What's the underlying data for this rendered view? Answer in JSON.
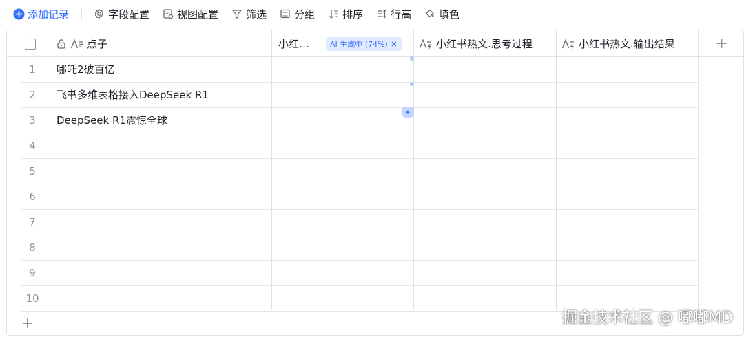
{
  "toolbar": {
    "add_record": "添加记录",
    "field_config": "字段配置",
    "view_config": "视图配置",
    "filter": "筛选",
    "group": "分组",
    "sort": "排序",
    "row_height": "行高",
    "fill_color": "填色"
  },
  "columns": {
    "primary": "点子",
    "col2": "小红…",
    "ai_badge": "AI 生成中 (74%)",
    "ai_badge_close": "×",
    "col3": "小红书热文.思考过程",
    "col4": "小红书热文.输出结果",
    "add": "+"
  },
  "rows": [
    {
      "num": "1",
      "text": "哪吒2破百亿"
    },
    {
      "num": "2",
      "text": "飞书多维表格接入DeepSeek R1"
    },
    {
      "num": "3",
      "text": "DeepSeek R1震惊全球"
    },
    {
      "num": "4",
      "text": ""
    },
    {
      "num": "5",
      "text": ""
    },
    {
      "num": "6",
      "text": ""
    },
    {
      "num": "7",
      "text": ""
    },
    {
      "num": "8",
      "text": ""
    },
    {
      "num": "9",
      "text": ""
    },
    {
      "num": "10",
      "text": ""
    }
  ],
  "add_row": "+",
  "watermark": "掘金技术社区 @ 嘟嘟MD",
  "colors": {
    "accent": "#3370ff",
    "border": "#dee0e3",
    "ai_badge_bg": "#e1eaff",
    "row_number": "#8f959e"
  },
  "icons": [
    "plus-circle-icon",
    "gear-icon",
    "view-config-icon",
    "filter-icon",
    "group-icon",
    "sort-icon",
    "row-height-icon",
    "fill-color-icon",
    "lock-icon",
    "text-field-icon",
    "ai-field-icon"
  ]
}
